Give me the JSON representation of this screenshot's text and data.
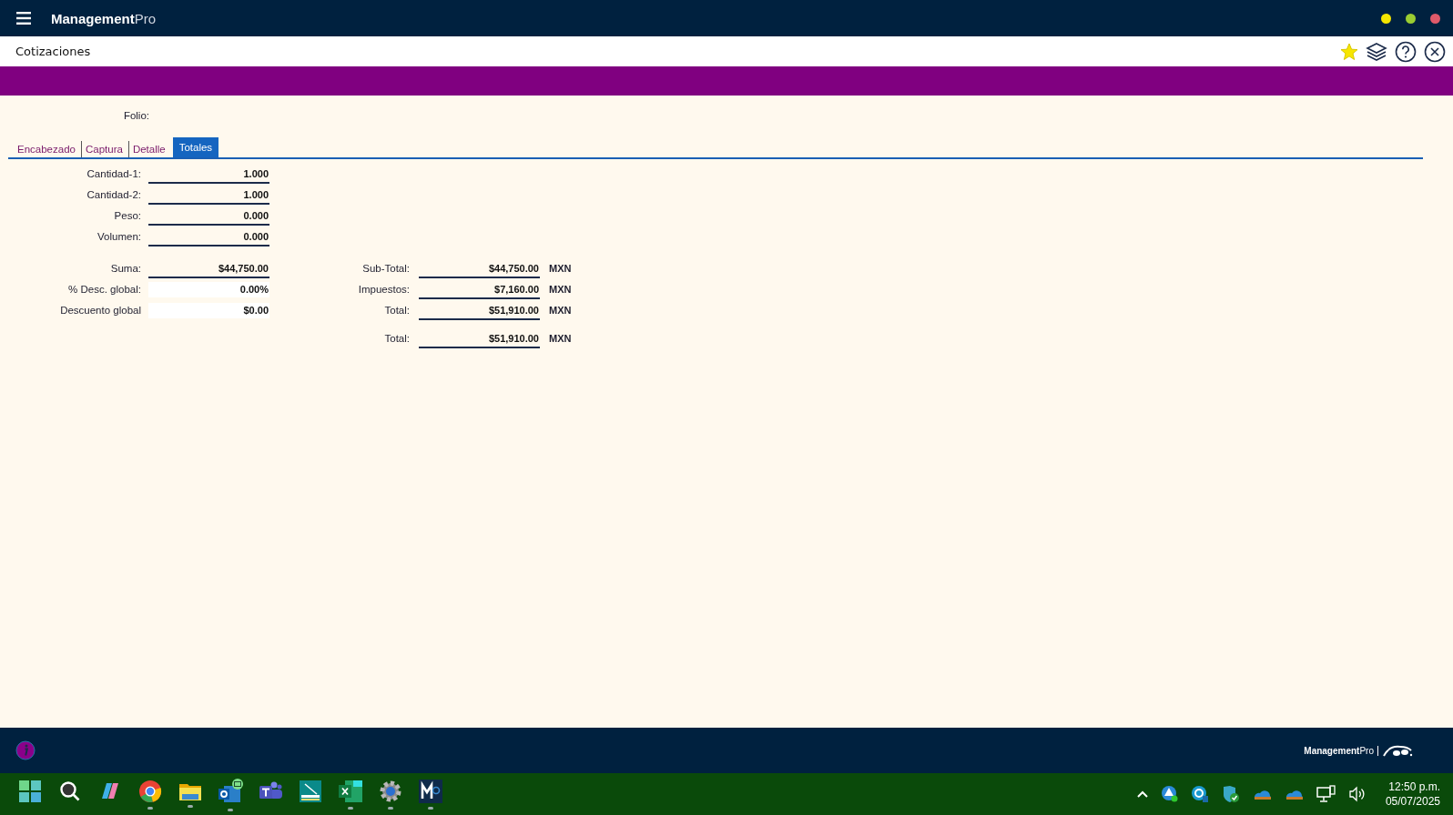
{
  "app": {
    "brand_main": "Management",
    "brand_sub": "Pro",
    "window_dots": [
      {
        "color": "#f5e600"
      },
      {
        "color": "#9acd32"
      },
      {
        "color": "#e05a6a"
      }
    ]
  },
  "page": {
    "title": "Cotizaciones",
    "favorite": true
  },
  "folio": {
    "label": "Folio:"
  },
  "tabs": [
    {
      "label": "Encabezado",
      "selected": false
    },
    {
      "label": "Captura",
      "selected": false
    },
    {
      "label": "Detalle",
      "selected": false
    },
    {
      "label": "Totales",
      "selected": true
    }
  ],
  "quantities": [
    {
      "label": "Cantidad-1:",
      "value": "1.000",
      "kind": "underlined"
    },
    {
      "label": "Cantidad-2:",
      "value": "1.000",
      "kind": "underlined"
    },
    {
      "label": "Peso:",
      "value": "0.000",
      "kind": "underlined"
    },
    {
      "label": "Volumen:",
      "value": "0.000",
      "kind": "underlined"
    }
  ],
  "amounts": [
    {
      "label": "Suma:",
      "value": "$44,750.00",
      "kind": "underlined"
    },
    {
      "label": "% Desc. global:",
      "value": "0.00%",
      "kind": "input"
    },
    {
      "label": "Descuento global",
      "value": "$0.00",
      "kind": "input"
    }
  ],
  "totals": [
    {
      "label": "Sub-Total:",
      "value": "$44,750.00",
      "currency": "MXN"
    },
    {
      "label": "Impuestos:",
      "value": "$7,160.00",
      "currency": "MXN"
    },
    {
      "label": "Total:",
      "value": "$51,910.00",
      "currency": "MXN"
    }
  ],
  "grand_total": {
    "label": "Total:",
    "value": "$51,910.00",
    "currency": "MXN"
  },
  "footer": {
    "brand_main": "Management",
    "brand_sub": "Pro"
  },
  "taskbar": {
    "apps": [
      {
        "kind": "start",
        "running": false
      },
      {
        "kind": "search",
        "running": false
      },
      {
        "kind": "copilot",
        "running": false
      },
      {
        "kind": "browser",
        "running": true
      },
      {
        "kind": "folder",
        "running": true
      },
      {
        "kind": "mail",
        "running": true
      },
      {
        "kind": "teams",
        "running": false
      },
      {
        "kind": "scanner",
        "running": false
      },
      {
        "kind": "sheet",
        "running": true
      },
      {
        "kind": "gear",
        "running": true
      },
      {
        "kind": "m",
        "running": true
      }
    ],
    "time": "12:50 p.m.",
    "date": "05/07/2025"
  }
}
